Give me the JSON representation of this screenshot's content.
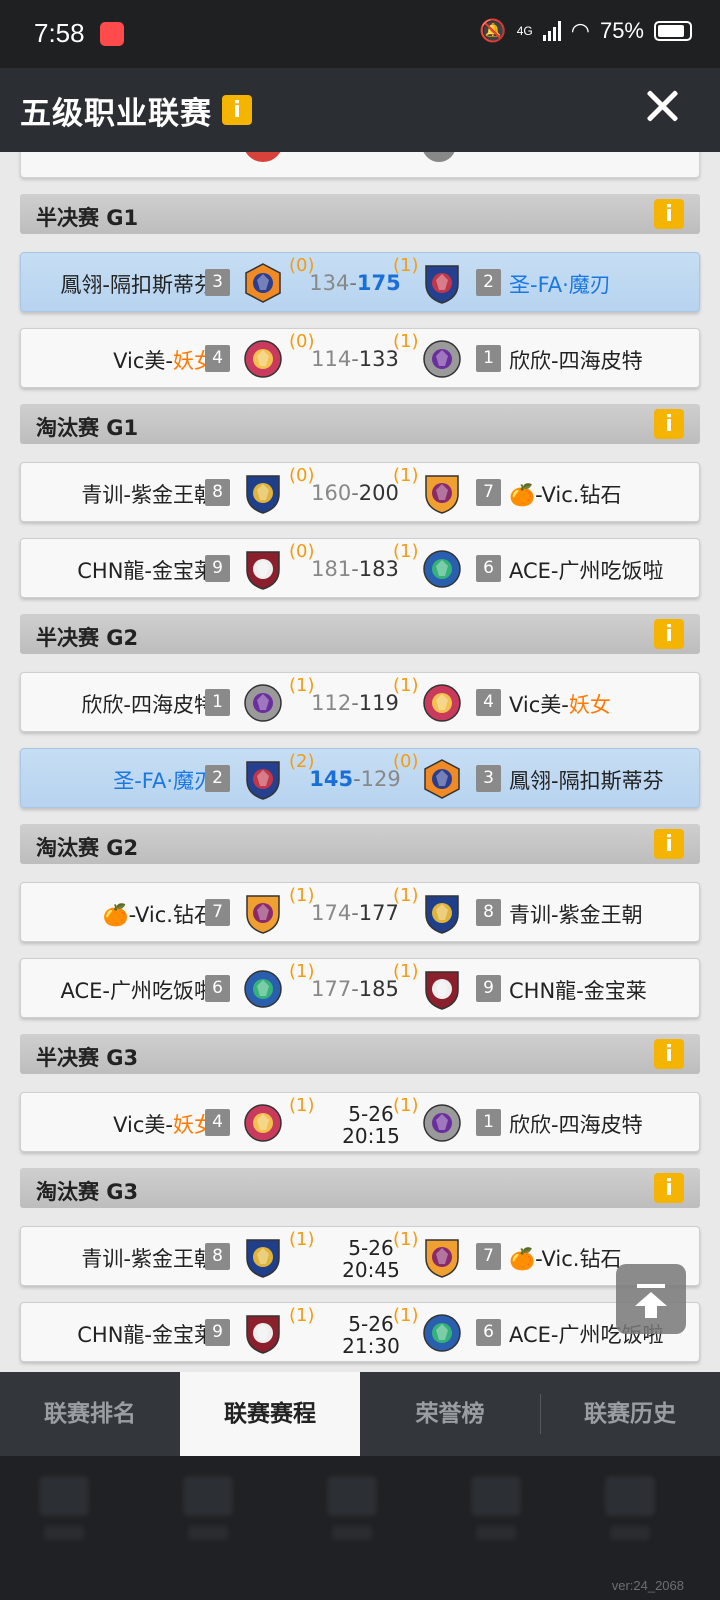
{
  "status_bar": {
    "time": "7:58",
    "network": "4G",
    "battery": "75%"
  },
  "header": {
    "title": "五级职业联赛",
    "info": "i"
  },
  "sections": [
    {
      "name": "半决赛 G1",
      "matches": [
        {
          "highlight": true,
          "left": {
            "name_plain": "鳳翎-隔扣斯蒂芬",
            "name_highlight": "",
            "seed": "3",
            "wins": "(0)",
            "score": "134",
            "logo": "wolf-logo"
          },
          "right": {
            "name_plain": "圣-FA·魔刃",
            "name_highlight": "",
            "seed": "2",
            "wins": "(1)",
            "score": "175",
            "logo": "dragon-logo"
          }
        },
        {
          "highlight": false,
          "left": {
            "name_plain": "Vic美-",
            "name_highlight": "妖女",
            "seed": "4",
            "wins": "(0)",
            "score": "114",
            "logo": "queen-logo"
          },
          "right": {
            "name_plain": "欣欣-四海皮特",
            "name_highlight": "",
            "seed": "1",
            "wins": "(1)",
            "score": "133",
            "logo": "serpent-logo"
          }
        }
      ]
    },
    {
      "name": "淘汰赛 G1",
      "matches": [
        {
          "highlight": false,
          "left": {
            "name_plain": "青训-紫金王朝",
            "name_highlight": "",
            "seed": "8",
            "wins": "(0)",
            "score": "160",
            "logo": "lion-logo"
          },
          "right": {
            "name_plain": "🍊-Vic.钻石",
            "name_highlight": "",
            "seed": "7",
            "wins": "(1)",
            "score": "200",
            "logo": "rocket-logo"
          }
        },
        {
          "highlight": false,
          "left": {
            "name_plain": "CHN龍-金宝莱",
            "name_highlight": "",
            "seed": "9",
            "wins": "(0)",
            "score": "181",
            "logo": "knight-logo"
          },
          "right": {
            "name_plain": "ACE-广州吃饭啦",
            "name_highlight": "",
            "seed": "6",
            "wins": "(1)",
            "score": "183",
            "logo": "unicorn-logo"
          }
        }
      ]
    },
    {
      "name": "半决赛 G2",
      "matches": [
        {
          "highlight": false,
          "left": {
            "name_plain": "欣欣-四海皮特",
            "name_highlight": "",
            "seed": "1",
            "wins": "(1)",
            "score": "112",
            "logo": "serpent-logo"
          },
          "right": {
            "name_plain": "Vic美-",
            "name_highlight": "妖女",
            "seed": "4",
            "wins": "(1)",
            "score": "119",
            "logo": "queen-logo"
          }
        },
        {
          "highlight": true,
          "left": {
            "name_plain": "圣-FA·魔刃",
            "name_highlight": "",
            "seed": "2",
            "wins": "(2)",
            "score": "145",
            "logo": "dragon-logo"
          },
          "right": {
            "name_plain": "鳳翎-隔扣斯蒂芬",
            "name_highlight": "",
            "seed": "3",
            "wins": "(0)",
            "score": "129",
            "logo": "wolf-logo"
          }
        }
      ]
    },
    {
      "name": "淘汰赛 G2",
      "matches": [
        {
          "highlight": false,
          "left": {
            "name_plain": "🍊-Vic.钻石",
            "name_highlight": "",
            "seed": "7",
            "wins": "(1)",
            "score": "174",
            "logo": "rocket-logo"
          },
          "right": {
            "name_plain": "青训-紫金王朝",
            "name_highlight": "",
            "seed": "8",
            "wins": "(1)",
            "score": "177",
            "logo": "lion-logo"
          }
        },
        {
          "highlight": false,
          "left": {
            "name_plain": "ACE-广州吃饭啦",
            "name_highlight": "",
            "seed": "6",
            "wins": "(1)",
            "score": "177",
            "logo": "unicorn-logo"
          },
          "right": {
            "name_plain": "CHN龍-金宝莱",
            "name_highlight": "",
            "seed": "9",
            "wins": "(1)",
            "score": "185",
            "logo": "knight-logo"
          }
        }
      ]
    },
    {
      "name": "半决赛 G3",
      "matches": [
        {
          "highlight": false,
          "date": "5-26",
          "time": "20:15",
          "left": {
            "name_plain": "Vic美-",
            "name_highlight": "妖女",
            "seed": "4",
            "wins": "(1)",
            "logo": "queen-logo"
          },
          "right": {
            "name_plain": "欣欣-四海皮特",
            "name_highlight": "",
            "seed": "1",
            "wins": "(1)",
            "logo": "serpent-logo"
          }
        }
      ]
    },
    {
      "name": "淘汰赛 G3",
      "matches": [
        {
          "highlight": false,
          "date": "5-26",
          "time": "20:45",
          "left": {
            "name_plain": "青训-紫金王朝",
            "name_highlight": "",
            "seed": "8",
            "wins": "(1)",
            "logo": "lion-logo"
          },
          "right": {
            "name_plain": "🍊-Vic.钻石",
            "name_highlight": "",
            "seed": "7",
            "wins": "(1)",
            "logo": "rocket-logo"
          }
        },
        {
          "highlight": false,
          "date": "5-26",
          "time": "21:30",
          "left": {
            "name_plain": "CHN龍-金宝莱",
            "name_highlight": "",
            "seed": "9",
            "wins": "(1)",
            "logo": "knight-logo"
          },
          "right": {
            "name_plain": "ACE-广州吃饭啦",
            "name_highlight": "",
            "seed": "6",
            "wins": "(1)",
            "logo": "unicorn-logo"
          }
        }
      ]
    }
  ],
  "tabs": [
    {
      "label": "联赛排名",
      "active": false
    },
    {
      "label": "联赛赛程",
      "active": true
    },
    {
      "label": "荣誉榜",
      "active": false
    },
    {
      "label": "联赛历史",
      "active": false
    }
  ],
  "version": "ver:24_2068",
  "colors": {
    "highlight_name": "#ff7a00",
    "winner_score": "#1a6fd6",
    "wins_count": "#f39c12",
    "seed_badge": "#8a8a8a",
    "info_badge": "#f5b400"
  }
}
